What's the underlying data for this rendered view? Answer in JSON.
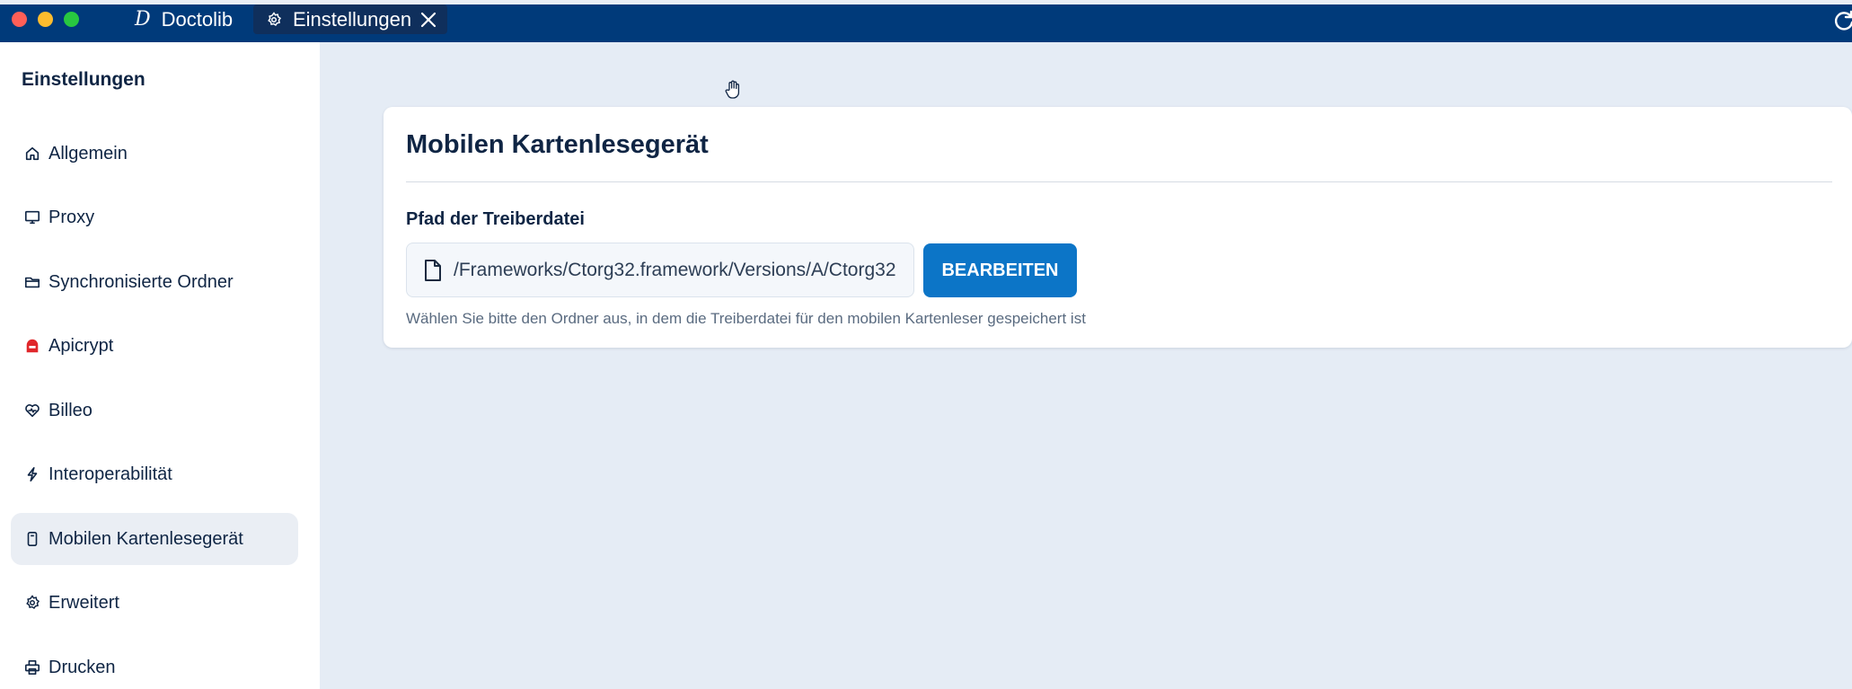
{
  "window": {
    "tabs": [
      {
        "label": "Doctolib",
        "glyph": "D"
      },
      {
        "label": "Einstellungen"
      }
    ],
    "colors": {
      "titlebar": "#003a7a",
      "accent": "#0c75c7"
    }
  },
  "sidebar": {
    "title": "Einstellungen",
    "items": [
      {
        "label": "Allgemein",
        "icon": "home-icon"
      },
      {
        "label": "Proxy",
        "icon": "monitor-icon"
      },
      {
        "label": "Synchronisierte Ordner",
        "icon": "folder-icon"
      },
      {
        "label": "Apicrypt",
        "icon": "apicrypt-icon"
      },
      {
        "label": "Billeo",
        "icon": "heart-icon"
      },
      {
        "label": "Interoperabilität",
        "icon": "lightning-icon"
      },
      {
        "label": "Mobilen Kartenlesegerät",
        "icon": "card-reader-icon",
        "active": true
      },
      {
        "label": "Erweitert",
        "icon": "gear-icon"
      },
      {
        "label": "Drucken",
        "icon": "printer-icon"
      }
    ]
  },
  "main": {
    "card": {
      "title": "Mobilen Kartenlesegerät",
      "field_label": "Pfad der Treiberdatei",
      "path_value": "Frameworks/Ctorg32.framework/Versions/A/Ctorg32/",
      "edit_label": "BEARBEITEN",
      "help_text": "Wählen Sie bitte den Ordner aus, in dem die Treiberdatei für den mobilen Kartenleser gespeichert ist"
    }
  }
}
